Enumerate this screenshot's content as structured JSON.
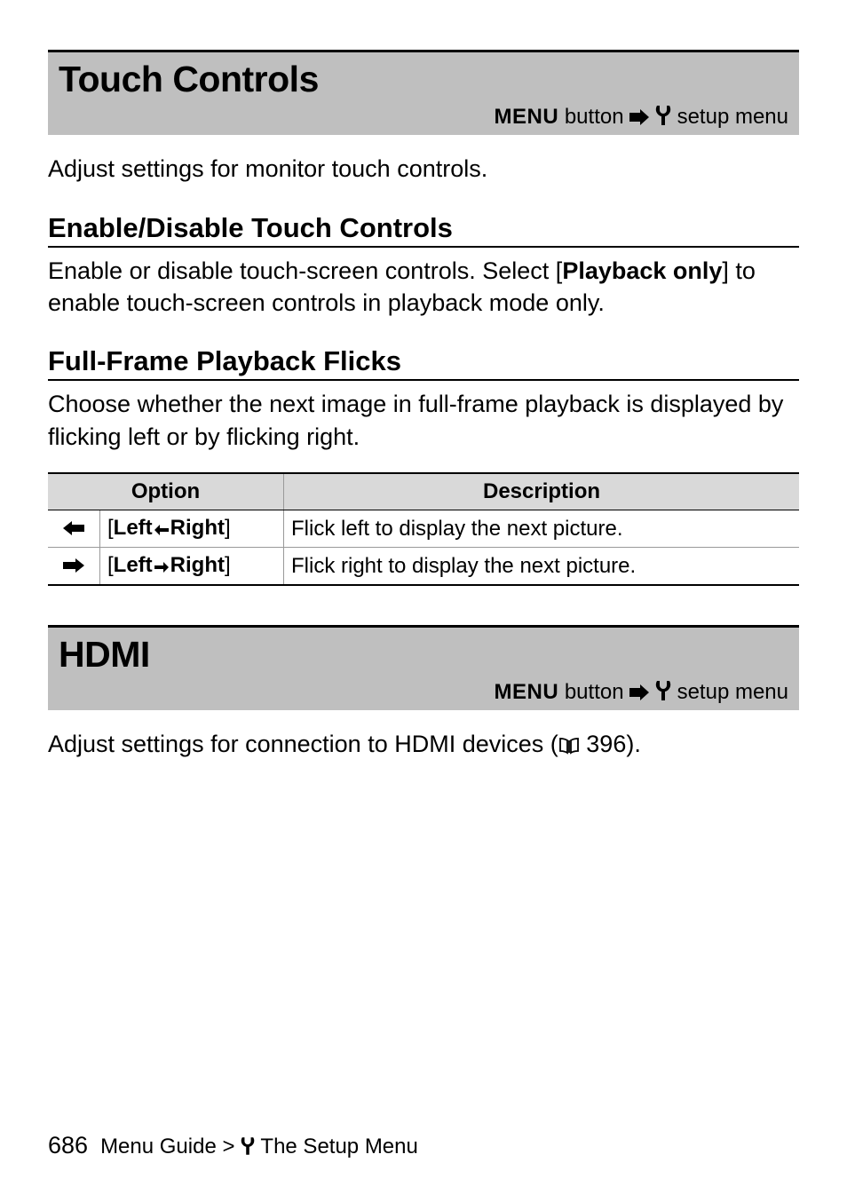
{
  "sections": {
    "touchControls": {
      "title": "Touch Controls",
      "menuPath": {
        "menuLabel": "MENU",
        "buttonWord": "button",
        "menuName": "setup menu"
      },
      "intro": "Adjust settings for monitor touch controls.",
      "enableDisable": {
        "heading": "Enable/Disable Touch Controls",
        "text_before": "Enable or disable touch-screen controls. Select [",
        "text_bold": "Playback only",
        "text_after": "] to enable touch-screen controls in playback mode only."
      },
      "flicks": {
        "heading": "Full-Frame Playback Flicks",
        "text": "Choose whether the next image in full-frame playback is displayed by flicking left or by flicking right.",
        "table": {
          "headers": {
            "option": "Option",
            "description": "Description"
          },
          "rows": [
            {
              "label_prefix": "[",
              "label_left": "Left",
              "label_arrow": "V",
              "label_right": "Right",
              "label_suffix": "]",
              "description": "Flick left to display the next picture."
            },
            {
              "label_prefix": "[",
              "label_left": "Left",
              "label_arrow": "W",
              "label_right": "Right",
              "label_suffix": "]",
              "description": "Flick right to display the next picture."
            }
          ]
        }
      }
    },
    "hdmi": {
      "title": "HDMI",
      "menuPath": {
        "menuLabel": "MENU",
        "buttonWord": "button",
        "menuName": "setup menu"
      },
      "text_before": "Adjust settings for connection to HDMI devices (",
      "page_ref": "396",
      "text_after": ")."
    }
  },
  "footer": {
    "pageNumber": "686",
    "crumb_prefix": "Menu Guide >",
    "crumb_suffix": "The Setup Menu"
  }
}
